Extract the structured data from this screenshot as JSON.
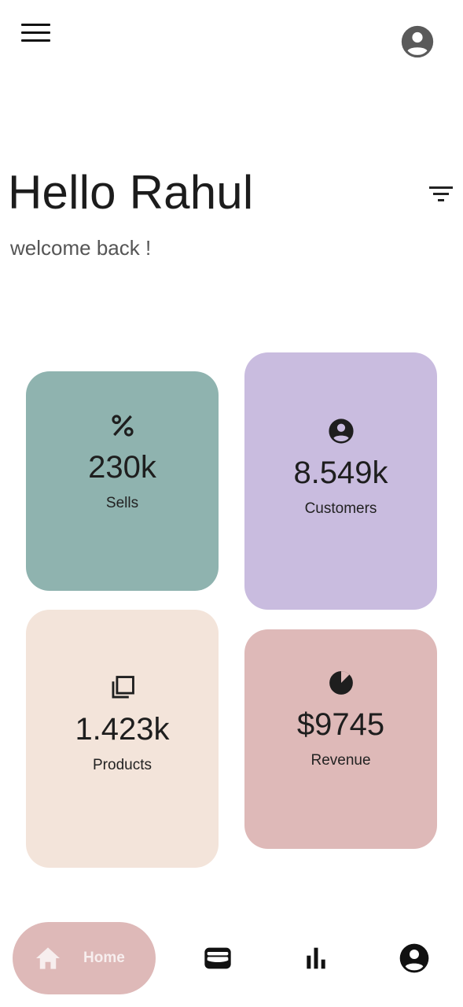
{
  "header": {
    "menu_icon": "hamburger-menu-icon",
    "account_icon": "account-circle-icon",
    "account_icon_color": "#5a5a5a"
  },
  "greeting": {
    "title": "Hello Rahul",
    "subtitle": "welcome back !",
    "filter_icon": "filter-list-icon"
  },
  "stats": [
    {
      "icon": "percent-icon",
      "value": "230k",
      "label": "Sells",
      "color": "#8fb3af"
    },
    {
      "icon": "account-circle-icon",
      "value": "8.549k",
      "label": "Customers",
      "color": "#c9bcdf"
    },
    {
      "icon": "library-copy-icon",
      "value": "1.423k",
      "label": "Products",
      "color": "#f3e4da"
    },
    {
      "icon": "pie-chart-icon",
      "value": "$9745",
      "label": "Revenue",
      "color": "#deb9b8"
    }
  ],
  "bottom_nav": {
    "home": {
      "label": "Home",
      "icon": "home-icon",
      "bg_color": "#deb9b8",
      "fg_color": "#f7eeee"
    },
    "items": [
      {
        "icon": "wallet-icon"
      },
      {
        "icon": "bar-chart-icon"
      },
      {
        "icon": "account-circle-icon"
      }
    ]
  }
}
